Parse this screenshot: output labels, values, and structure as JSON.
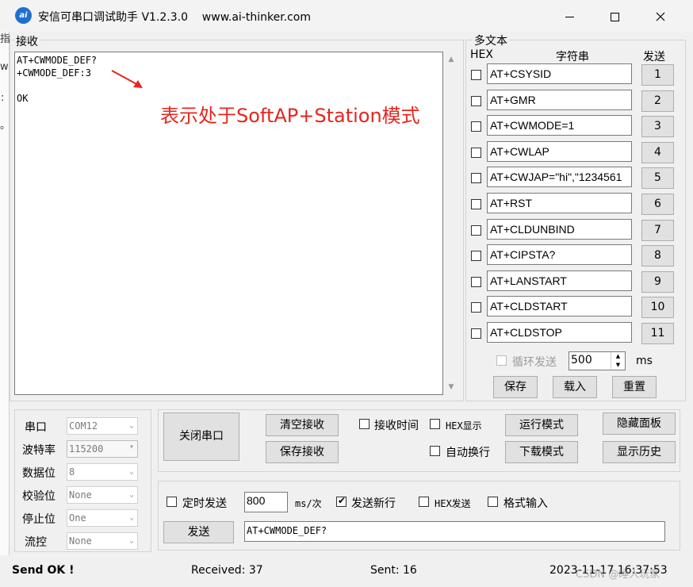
{
  "window": {
    "title": "安信可串口调试助手 V1.2.3.0    www.ai-thinker.com",
    "icon_text": "ai",
    "minimize_icon": "minimize-icon",
    "maximize_icon": "maximize-icon",
    "close_icon": "close-icon"
  },
  "background_window": {
    "fragments": [
      "指",
      "w",
      ":",
      "。"
    ]
  },
  "receive": {
    "label": "接收",
    "lines": "AT+CWMODE_DEF?\n+CWMODE_DEF:3\n\nOK",
    "annotation": "表示处于SoftAP+Station模式",
    "annotation_color": "#e6251e"
  },
  "multi_text": {
    "label": "多文本",
    "col_hex": "HEX",
    "col_string": "字符串",
    "col_send": "发送",
    "rows": [
      {
        "cmd": "AT+CSYSID",
        "num": "1"
      },
      {
        "cmd": "AT+GMR",
        "num": "2"
      },
      {
        "cmd": "AT+CWMODE=1",
        "num": "3"
      },
      {
        "cmd": "AT+CWLAP",
        "num": "4"
      },
      {
        "cmd": "AT+CWJAP=\"hi\",\"1234561",
        "num": "5"
      },
      {
        "cmd": "AT+RST",
        "num": "6"
      },
      {
        "cmd": "AT+CLDUNBIND",
        "num": "7"
      },
      {
        "cmd": "AT+CIPSTA?",
        "num": "8"
      },
      {
        "cmd": "AT+LANSTART",
        "num": "9"
      },
      {
        "cmd": "AT+CLDSTART",
        "num": "10"
      },
      {
        "cmd": "AT+CLDSTOP",
        "num": "11"
      }
    ],
    "loop_send_label": "循环发送",
    "loop_interval": "500",
    "loop_unit": "ms",
    "save_label": "保存",
    "load_label": "载入",
    "reset_label": "重置"
  },
  "serial": {
    "port_label": "串口",
    "port_value": "COM12",
    "baud_label": "波特率",
    "baud_value": "115200",
    "databits_label": "数据位",
    "databits_value": "8",
    "parity_label": "校验位",
    "parity_value": "None",
    "stopbits_label": "停止位",
    "stopbits_value": "One",
    "flow_label": "流控",
    "flow_value": "None"
  },
  "controls": {
    "close_port": "关闭串口",
    "clear_recv": "清空接收",
    "save_recv": "保存接收",
    "recv_time": "接收时间",
    "hex_display": "HEX显示",
    "run_mode": "运行模式",
    "hide_panel": "隐藏面板",
    "auto_wrap": "自动换行",
    "download_mode": "下载模式",
    "show_history": "显示历史"
  },
  "send": {
    "timed_send": "定时发送",
    "interval": "800",
    "interval_unit": "ms/次",
    "new_line": "发送新行",
    "hex_send": "HEX发送",
    "format_input": "格式输入",
    "send_button": "发送",
    "send_text": "AT+CWMODE_DEF?"
  },
  "status": {
    "send_ok": "Send OK !",
    "received": "Received: 37",
    "sent": "Sent: 16",
    "datetime": "2023-11-17 16:37:53",
    "watermark": "CSDN @睡人玩家"
  }
}
